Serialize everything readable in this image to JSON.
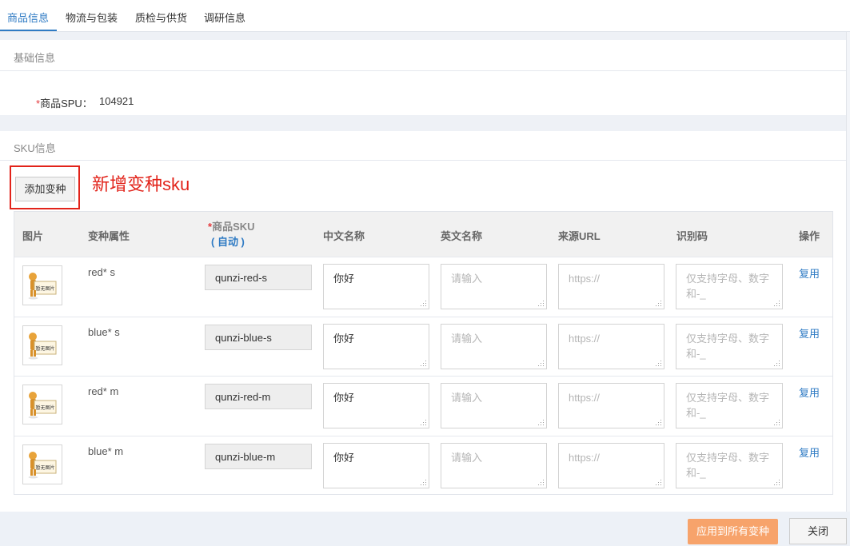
{
  "tabs": [
    {
      "label": "商品信息",
      "active": true
    },
    {
      "label": "物流与包装",
      "active": false
    },
    {
      "label": "质检与供货",
      "active": false
    },
    {
      "label": "调研信息",
      "active": false
    }
  ],
  "basic": {
    "title": "基础信息",
    "spu_required_mark": "*",
    "spu_label": "商品SPU：",
    "spu_value": "104921"
  },
  "sku": {
    "title": "SKU信息",
    "add_variant_label": "添加变种",
    "annotation": "新增变种sku",
    "headers": {
      "image": "图片",
      "variant_attr": "变种属性",
      "sku_required_mark": "*",
      "sku": "商品SKU",
      "sku_auto": "( 自动 )",
      "cn_name": "中文名称",
      "en_name": "英文名称",
      "source_url": "来源URL",
      "identifier": "识别码",
      "operation": "操作"
    },
    "placeholders": {
      "en_name": "请输入",
      "source_url": "https://",
      "identifier": "仅支持字母、数字和-_"
    },
    "thumb_text": "暂无图片",
    "rows": [
      {
        "attr": "red* s",
        "sku": "qunzi-red-s",
        "cn_name": "你好",
        "op": "复用"
      },
      {
        "attr": "blue* s",
        "sku": "qunzi-blue-s",
        "cn_name": "你好",
        "op": "复用"
      },
      {
        "attr": "red* m",
        "sku": "qunzi-red-m",
        "cn_name": "你好",
        "op": "复用"
      },
      {
        "attr": "blue* m",
        "sku": "qunzi-blue-m",
        "cn_name": "你好",
        "op": "复用"
      }
    ]
  },
  "footer": {
    "apply_all_label": "应用到所有变种",
    "close_label": "关闭"
  },
  "colors": {
    "accent": "#2f7bc4",
    "annotation_red": "#e2231a",
    "apply_button": "#f7a36b"
  }
}
